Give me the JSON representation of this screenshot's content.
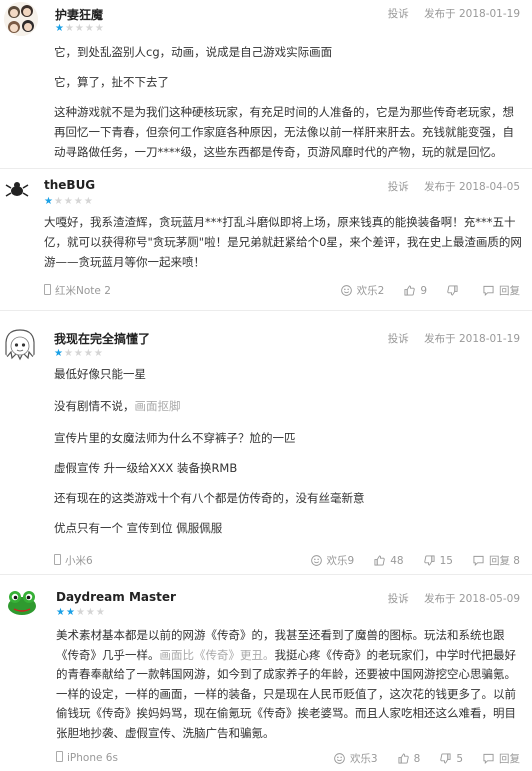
{
  "colors": {
    "star_active": "#1aa0e6",
    "star_inactive": "#d5d5d5",
    "muted": "#999999"
  },
  "reviews": [
    {
      "username": "护妻狂魔",
      "rating": 1,
      "report": "投诉",
      "posted": "发布于 2018-01-19",
      "avatar_icon": "avatar-anime-group-icon",
      "paragraphs": [
        "它，到处乱盗别人cg，动画，说成是自己游戏实际画面",
        "它，算了，扯不下去了",
        "这种游戏就不是为我们这种硬核玩家，有充足时间的人准备的，它是为那些传奇老玩家，想再回忆一下青春，但奈何工作家庭各种原因，无法像以前一样肝来肝去。充钱就能变强，自动寻路做任务，一刀****级，这些东西都是传奇，页游风靡时代的产物，玩的就是回忆。"
      ]
    },
    {
      "username": "theBUG",
      "rating": 1,
      "report": "投诉",
      "posted": "发布于 2018-04-05",
      "avatar_icon": "avatar-insect-icon",
      "paragraphs": [
        "大嘎好，我系渣渣辉，贪玩蓝月***打乱斗磨似即将上场，原来钱真的能换装备啊！充***五十亿，就可以获得称号\"贪玩茅厕\"啦！是兄弟就赶紧给个0星，来个差评，我在史上最渣画质的网游——贪玩蓝月等你一起来喷！"
      ],
      "device": "红米Note 2",
      "funny_count": "欢乐2",
      "like_count": "9",
      "dislike_count": "",
      "reply_label": "回复"
    },
    {
      "username": "我现在完全搞懂了",
      "rating": 1,
      "report": "投诉",
      "posted": "发布于 2018-01-19",
      "avatar_icon": "avatar-sketch-girl-icon",
      "paragraphs": [
        "最低好像只能一星",
        "没有剧情不说，",
        "宣传片里的女魔法师为什么不穿裤子？尬的一匹",
        "虚假宣传 升一级给XXX 装备换RMB",
        "还有现在的这类游戏十个有八个都是仿传奇的，没有丝毫新意",
        "优点只有一个 宣传到位 佩服佩服"
      ],
      "muted_snippet": "画面抠脚",
      "device": "小米6",
      "funny_count": "欢乐9",
      "like_count": "48",
      "dislike_count": "15",
      "reply_label": "回复 8"
    },
    {
      "username": "Daydream Master",
      "rating": 2,
      "report": "投诉",
      "posted": "发布于 2018-05-09",
      "avatar_icon": "avatar-frog-icon",
      "paragraphs": [
        "美术素材基本都是以前的网游《传奇》的，我甚至还看到了魔兽的图标。玩法和系统也跟《传奇》几乎一样。",
        "我挺心疼《传奇》的老玩家们，中学时代把最好的青春奉献给了一款韩国网游，如今到了成家养子的年龄，还要被中国网游挖空心思骗氪。一样的设定，一样的画面，一样的装备，只是现在人民币贬值了，这次花的钱更多了。以前偷钱玩《传奇》挨妈妈骂，现在偷氪玩《传奇》挨老婆骂。而且人家吃相还这么难看，明目张胆地抄袭、虚假宣传、洗脑广告和骗氪。"
      ],
      "muted_snippet": "画面比《传奇》更丑。",
      "device": "iPhone 6s",
      "funny_count": "欢乐3",
      "like_count": "8",
      "dislike_count": "5",
      "reply_label": "回复"
    }
  ]
}
